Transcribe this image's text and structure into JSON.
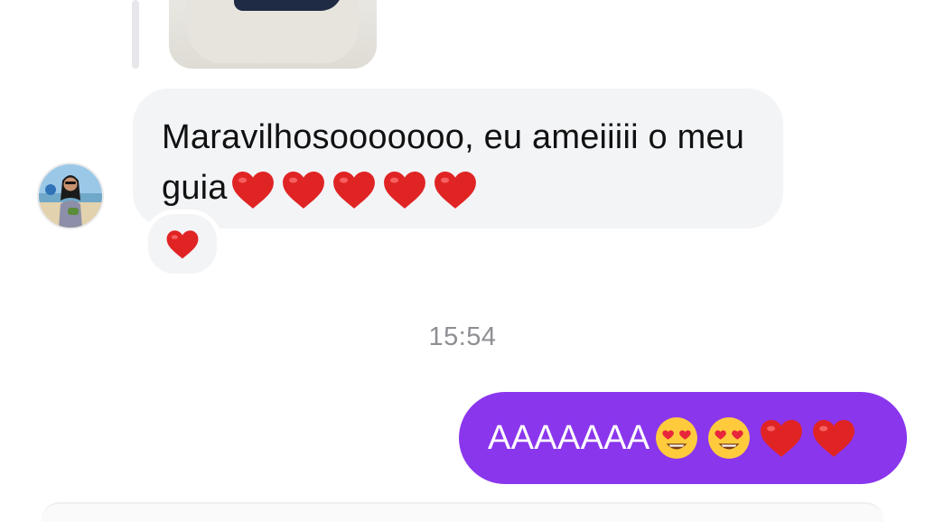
{
  "messages": {
    "received": {
      "text": "Maravilhosooooooo, eu ameiiiii o meu guia",
      "hearts": 5,
      "reaction": "red-heart"
    },
    "timestamp": "15:54",
    "sent": {
      "text": "AAAAAAA",
      "emojis": [
        "smiling-face-with-heart-eyes",
        "smiling-face-with-heart-eyes",
        "red-heart",
        "red-heart"
      ]
    }
  },
  "colors": {
    "sent_bubble": "#8a36ed",
    "received_bubble": "#f3f4f6",
    "heart": "#e02424",
    "timestamp": "#8e8e93"
  }
}
